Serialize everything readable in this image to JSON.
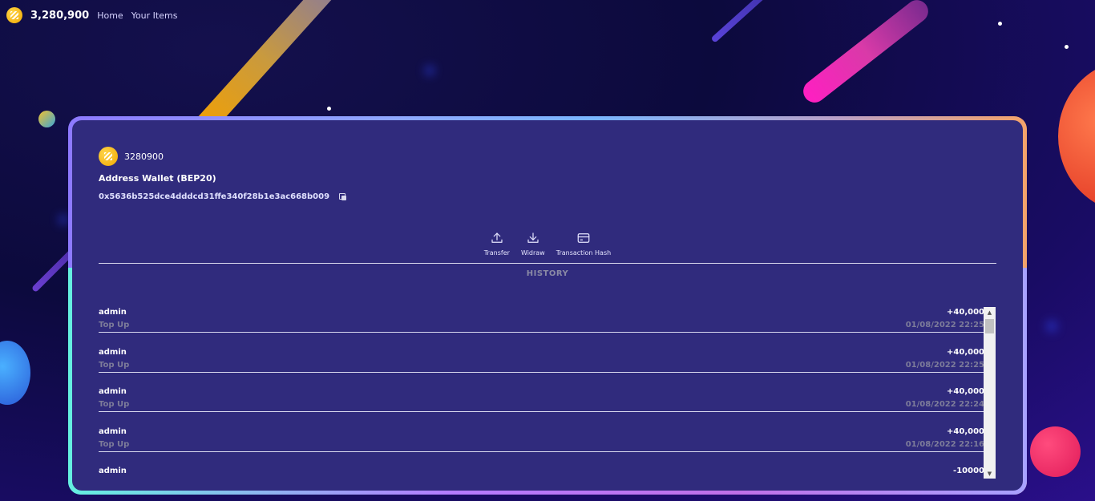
{
  "topbar": {
    "coin_icon": "token-coin-icon",
    "balance": "3,280,900",
    "nav": [
      "Home",
      "Your Items"
    ]
  },
  "wallet": {
    "balance": "3280900",
    "address_title": "Address Wallet (BEP20)",
    "address": "0x5636b525dce4dddcd31ffe340f28b1e3ac668b009",
    "copy_icon": "copy-icon"
  },
  "actions": [
    {
      "label": "Transfer",
      "icon": "upload-icon"
    },
    {
      "label": "Widraw",
      "icon": "download-icon"
    },
    {
      "label": "Transaction Hash",
      "icon": "card-icon"
    }
  ],
  "history": {
    "title": "HISTORY",
    "rows": [
      {
        "name": "admin",
        "type": "Top Up",
        "amount": "+40,000",
        "date": "01/08/2022 22:25"
      },
      {
        "name": "admin",
        "type": "Top Up",
        "amount": "+40,000",
        "date": "01/08/2022 22:25"
      },
      {
        "name": "admin",
        "type": "Top Up",
        "amount": "+40,000",
        "date": "01/08/2022 22:24"
      },
      {
        "name": "admin",
        "type": "Top Up",
        "amount": "+40,000",
        "date": "01/08/2022 22:16"
      },
      {
        "name": "admin",
        "type": "",
        "amount": "-10000",
        "date": ""
      }
    ]
  },
  "colors": {
    "card_bg": "#302b7d",
    "coin": "#f0a800"
  }
}
